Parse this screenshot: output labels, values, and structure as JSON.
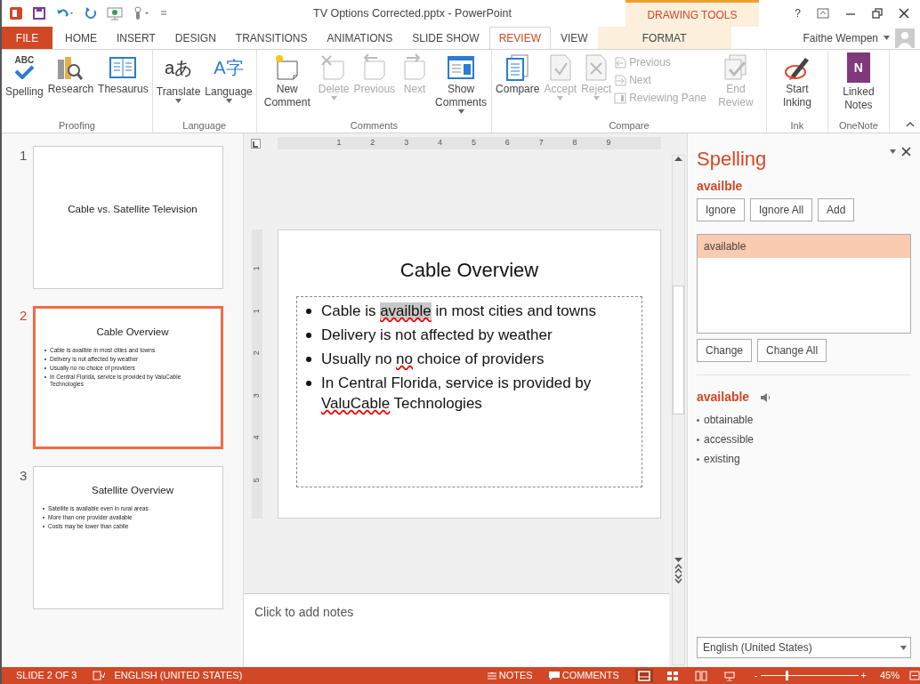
{
  "window": {
    "title": "TV Options Corrected.pptx - PowerPoint",
    "context_label": "DRAWING TOOLS",
    "help": "?",
    "user": "Faithe Wempen"
  },
  "tabs": [
    {
      "label": "FILE",
      "kind": "file",
      "selected": false
    },
    {
      "label": "HOME",
      "kind": "normal",
      "selected": false
    },
    {
      "label": "INSERT",
      "kind": "normal",
      "selected": false
    },
    {
      "label": "DESIGN",
      "kind": "normal",
      "selected": false
    },
    {
      "label": "TRANSITIONS",
      "kind": "normal",
      "selected": false
    },
    {
      "label": "ANIMATIONS",
      "kind": "normal",
      "selected": false
    },
    {
      "label": "SLIDE SHOW",
      "kind": "normal",
      "selected": false
    },
    {
      "label": "REVIEW",
      "kind": "normal",
      "selected": true
    },
    {
      "label": "VIEW",
      "kind": "normal",
      "selected": false
    },
    {
      "label": "FORMAT",
      "kind": "contextual",
      "selected": false
    }
  ],
  "ribbon_groups": [
    {
      "label": "Proofing",
      "commands": [
        {
          "label": "Spelling",
          "kind": "large",
          "icon_text": "ABC",
          "disabled": false,
          "dropdown": false
        },
        {
          "label": "Research",
          "kind": "large",
          "disabled": false,
          "dropdown": false
        },
        {
          "label": "Thesaurus",
          "kind": "large",
          "disabled": false,
          "dropdown": false
        }
      ]
    },
    {
      "label": "Language",
      "commands": [
        {
          "label": "Translate",
          "kind": "large",
          "icon_text": "aあ",
          "disabled": false,
          "dropdown": true
        },
        {
          "label": "Language",
          "kind": "large",
          "icon_text": "A字",
          "disabled": false,
          "dropdown": true
        }
      ]
    },
    {
      "label": "Comments",
      "commands": [
        {
          "label": "New Comment",
          "kind": "large",
          "disabled": false,
          "dropdown": false
        },
        {
          "label": "Delete",
          "kind": "large",
          "disabled": true,
          "dropdown": true
        },
        {
          "label": "Previous",
          "kind": "large",
          "disabled": true,
          "dropdown": false
        },
        {
          "label": "Next",
          "kind": "large",
          "disabled": true,
          "dropdown": false
        },
        {
          "label": "Show Comments",
          "kind": "large",
          "disabled": false,
          "dropdown": true
        }
      ]
    },
    {
      "label": "Compare",
      "commands": [
        {
          "label": "Compare",
          "kind": "large",
          "disabled": false,
          "dropdown": false
        },
        {
          "label": "Accept",
          "kind": "large",
          "disabled": true,
          "dropdown": true
        },
        {
          "label": "Reject",
          "kind": "large",
          "disabled": true,
          "dropdown": true
        },
        {
          "label": "Previous",
          "kind": "small",
          "disabled": true
        },
        {
          "label": "Next",
          "kind": "small",
          "disabled": true
        },
        {
          "label": "Reviewing Pane",
          "kind": "small",
          "disabled": true
        },
        {
          "label": "End Review",
          "kind": "large",
          "disabled": true,
          "dropdown": false
        }
      ]
    },
    {
      "label": "Ink",
      "commands": [
        {
          "label": "Start Inking",
          "kind": "large",
          "disabled": false,
          "dropdown": false
        }
      ]
    },
    {
      "label": "OneNote",
      "commands": [
        {
          "label": "Linked Notes",
          "kind": "large",
          "icon_text": "N",
          "disabled": false,
          "dropdown": false
        }
      ]
    }
  ],
  "slides": [
    {
      "number": "1",
      "title": "Cable vs. Satellite Television",
      "selected": false
    },
    {
      "number": "2",
      "title": "Cable Overview",
      "bullets": [
        "Cable is availble in most cities and towns",
        "Delivery is not affected by weather",
        "Usually no no choice of providers",
        "In Central Florida, service is provided by ValuCable Technologies"
      ],
      "selected": true
    },
    {
      "number": "3",
      "title": "Satellite Overview",
      "bullets": [
        "Satellite is available even in rural areas",
        "More than one provider available",
        "Costs may be lower than cablle"
      ],
      "selected": false
    }
  ],
  "ruler": {
    "horizontal": [
      "1",
      "2",
      "3",
      "4",
      "5",
      "6",
      "7",
      "8",
      "9"
    ],
    "vertical": [
      "1",
      "1",
      "2",
      "3",
      "4",
      "5"
    ]
  },
  "slide": {
    "title": "Cable Overview",
    "bullets": [
      [
        {
          "text": "Cable is "
        },
        {
          "text": "availble",
          "kind": "flagged"
        },
        {
          "text": " in most cities and towns"
        }
      ],
      [
        {
          "text": "Delivery is not affected by weather"
        }
      ],
      [
        {
          "text": "Usually no "
        },
        {
          "text": "no",
          "kind": "misspelled"
        },
        {
          "text": " choice of providers"
        }
      ],
      [
        {
          "text": "In Central Florida, service is provided by "
        },
        {
          "text": "ValuCable",
          "kind": "misspelled"
        },
        {
          "text": " Technologies"
        }
      ]
    ]
  },
  "notes": {
    "placeholder": "Click to add notes"
  },
  "spelling": {
    "title": "Spelling",
    "word": "availble",
    "buttons": [
      "Ignore",
      "Ignore All",
      "Add"
    ],
    "suggestions": [
      {
        "text": "available",
        "selected": true
      }
    ],
    "change_buttons": [
      "Change",
      "Change All"
    ],
    "definition_word": "available",
    "synonyms": [
      "obtainable",
      "accessible",
      "existing"
    ],
    "language": "English (United States)"
  },
  "status_bar": {
    "slide": "SLIDE 2 OF 3",
    "language": "ENGLISH (UNITED STATES)",
    "notes": "NOTES",
    "comments": "COMMENTS",
    "views": [
      {
        "selected": true
      },
      {
        "selected": false
      },
      {
        "selected": false
      },
      {
        "selected": false
      }
    ],
    "zoom_out": "-",
    "zoom_slider": {
      "level": 0.27
    },
    "zoom_in": "+",
    "zoom": "45%"
  }
}
